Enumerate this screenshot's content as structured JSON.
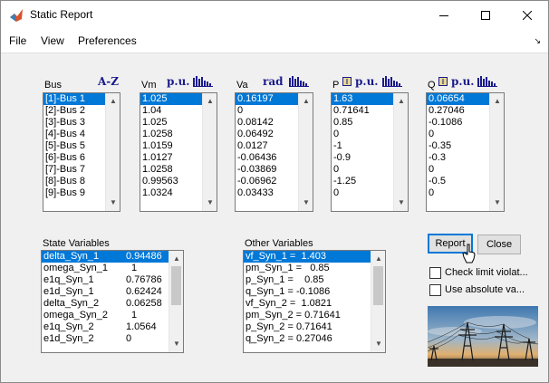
{
  "window": {
    "title": "Static Report",
    "icon": "matlab-icon"
  },
  "menu": [
    "File",
    "View",
    "Preferences"
  ],
  "bus": {
    "header": "Bus",
    "sort_tool": "A-Z",
    "items": [
      "[1]-Bus 1",
      "[2]-Bus 2",
      "[3]-Bus 3",
      "[4]-Bus 4",
      "[5]-Bus 5",
      "[6]-Bus 6",
      "[7]-Bus 7",
      "[8]-Bus 8",
      "[9]-Bus 9"
    ]
  },
  "vm": {
    "header": "Vm",
    "unit_tool": "p.u.",
    "items": [
      "1.025",
      "1.04",
      "1.025",
      "1.0258",
      "1.0159",
      "1.0127",
      "1.0258",
      "0.99563",
      "1.0324"
    ]
  },
  "va": {
    "header": "Va",
    "unit_tool": "rad",
    "items": [
      "0.16197",
      "0",
      "0.08142",
      "0.06492",
      "0.0127",
      "-0.06436",
      "-0.03869",
      "-0.06962",
      "0.03433"
    ]
  },
  "p": {
    "header": "P",
    "unit_tool": "p.u.",
    "items": [
      "1.63",
      "0.71641",
      "0.85",
      "0",
      "-1",
      "-0.9",
      "0",
      "-1.25",
      "0"
    ]
  },
  "q": {
    "header": "Q",
    "unit_tool": "p.u.",
    "items": [
      "0.06654",
      "0.27046",
      "-0.1086",
      "0",
      "-0.35",
      "-0.3",
      "0",
      "-0.5",
      "0"
    ]
  },
  "state_vars": {
    "header": "State Variables",
    "items": [
      {
        "name": "delta_Syn_1",
        "value": "0.94486"
      },
      {
        "name": "omega_Syn_1",
        "value": "1"
      },
      {
        "name": "e1q_Syn_1",
        "value": "0.76786"
      },
      {
        "name": "e1d_Syn_1",
        "value": "0.62424"
      },
      {
        "name": "delta_Syn_2",
        "value": "0.06258"
      },
      {
        "name": "omega_Syn_2",
        "value": "1"
      },
      {
        "name": "e1q_Syn_2",
        "value": "1.0564"
      },
      {
        "name": "e1d_Syn_2",
        "value": "0"
      }
    ]
  },
  "other_vars": {
    "header": "Other Variables",
    "items": [
      "vf_Syn_1 =  1.403",
      "pm_Syn_1 =   0.85",
      "p_Syn_1 =    0.85",
      "q_Syn_1 = -0.1086",
      "vf_Syn_2 =  1.0821",
      "pm_Syn_2 = 0.71641",
      "p_Syn_2 = 0.71641",
      "q_Syn_2 = 0.27046"
    ]
  },
  "buttons": {
    "report": "Report",
    "close": "Close"
  },
  "checkboxes": {
    "limits": "Check limit violat...",
    "absolute": "Use absolute va..."
  },
  "colors": {
    "selection": "#0078d7",
    "tool": "#1a1a8c"
  }
}
